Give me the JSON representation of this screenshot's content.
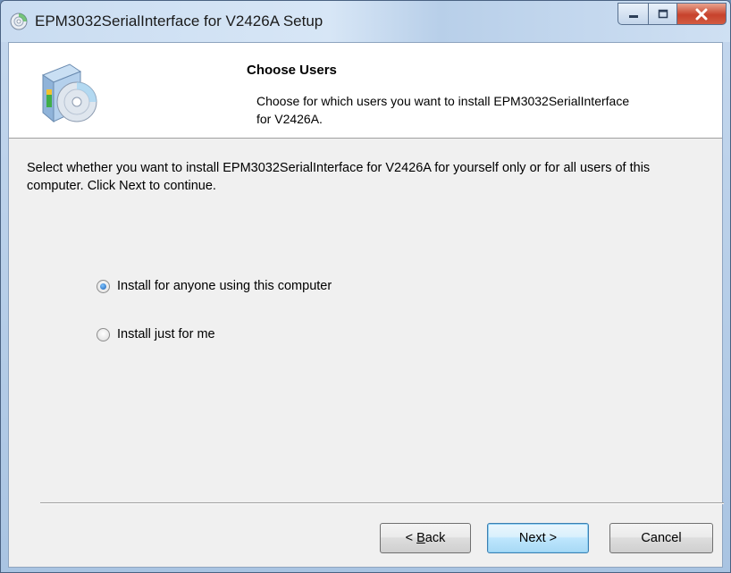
{
  "window": {
    "title": "EPM3032SerialInterface for V2426A Setup",
    "caption_buttons": [
      "minimize",
      "maximize",
      "close"
    ]
  },
  "header": {
    "title": "Choose Users",
    "subtitle": "Choose for which users you want to install EPM3032SerialInterface for V2426A."
  },
  "body": {
    "description": "Select whether you want to install EPM3032SerialInterface for V2426A for yourself only or for all users of this computer. Click Next to continue.",
    "options": [
      {
        "label": "Install for anyone using this computer",
        "selected": true
      },
      {
        "label": "Install just for me",
        "selected": false
      }
    ]
  },
  "footer": {
    "back_prefix": "< ",
    "back_accel": "B",
    "back_rest": "ack",
    "next_label": "Next >",
    "cancel_label": "Cancel"
  },
  "colors": {
    "title_bar": "#c9dcf1",
    "close_button": "#c7422c",
    "client_bg": "#f0f0f0",
    "default_button_border": "#3c7fb1"
  },
  "icons": {
    "app": "installer-disc-icon",
    "header": "installer-box-cd-icon"
  }
}
